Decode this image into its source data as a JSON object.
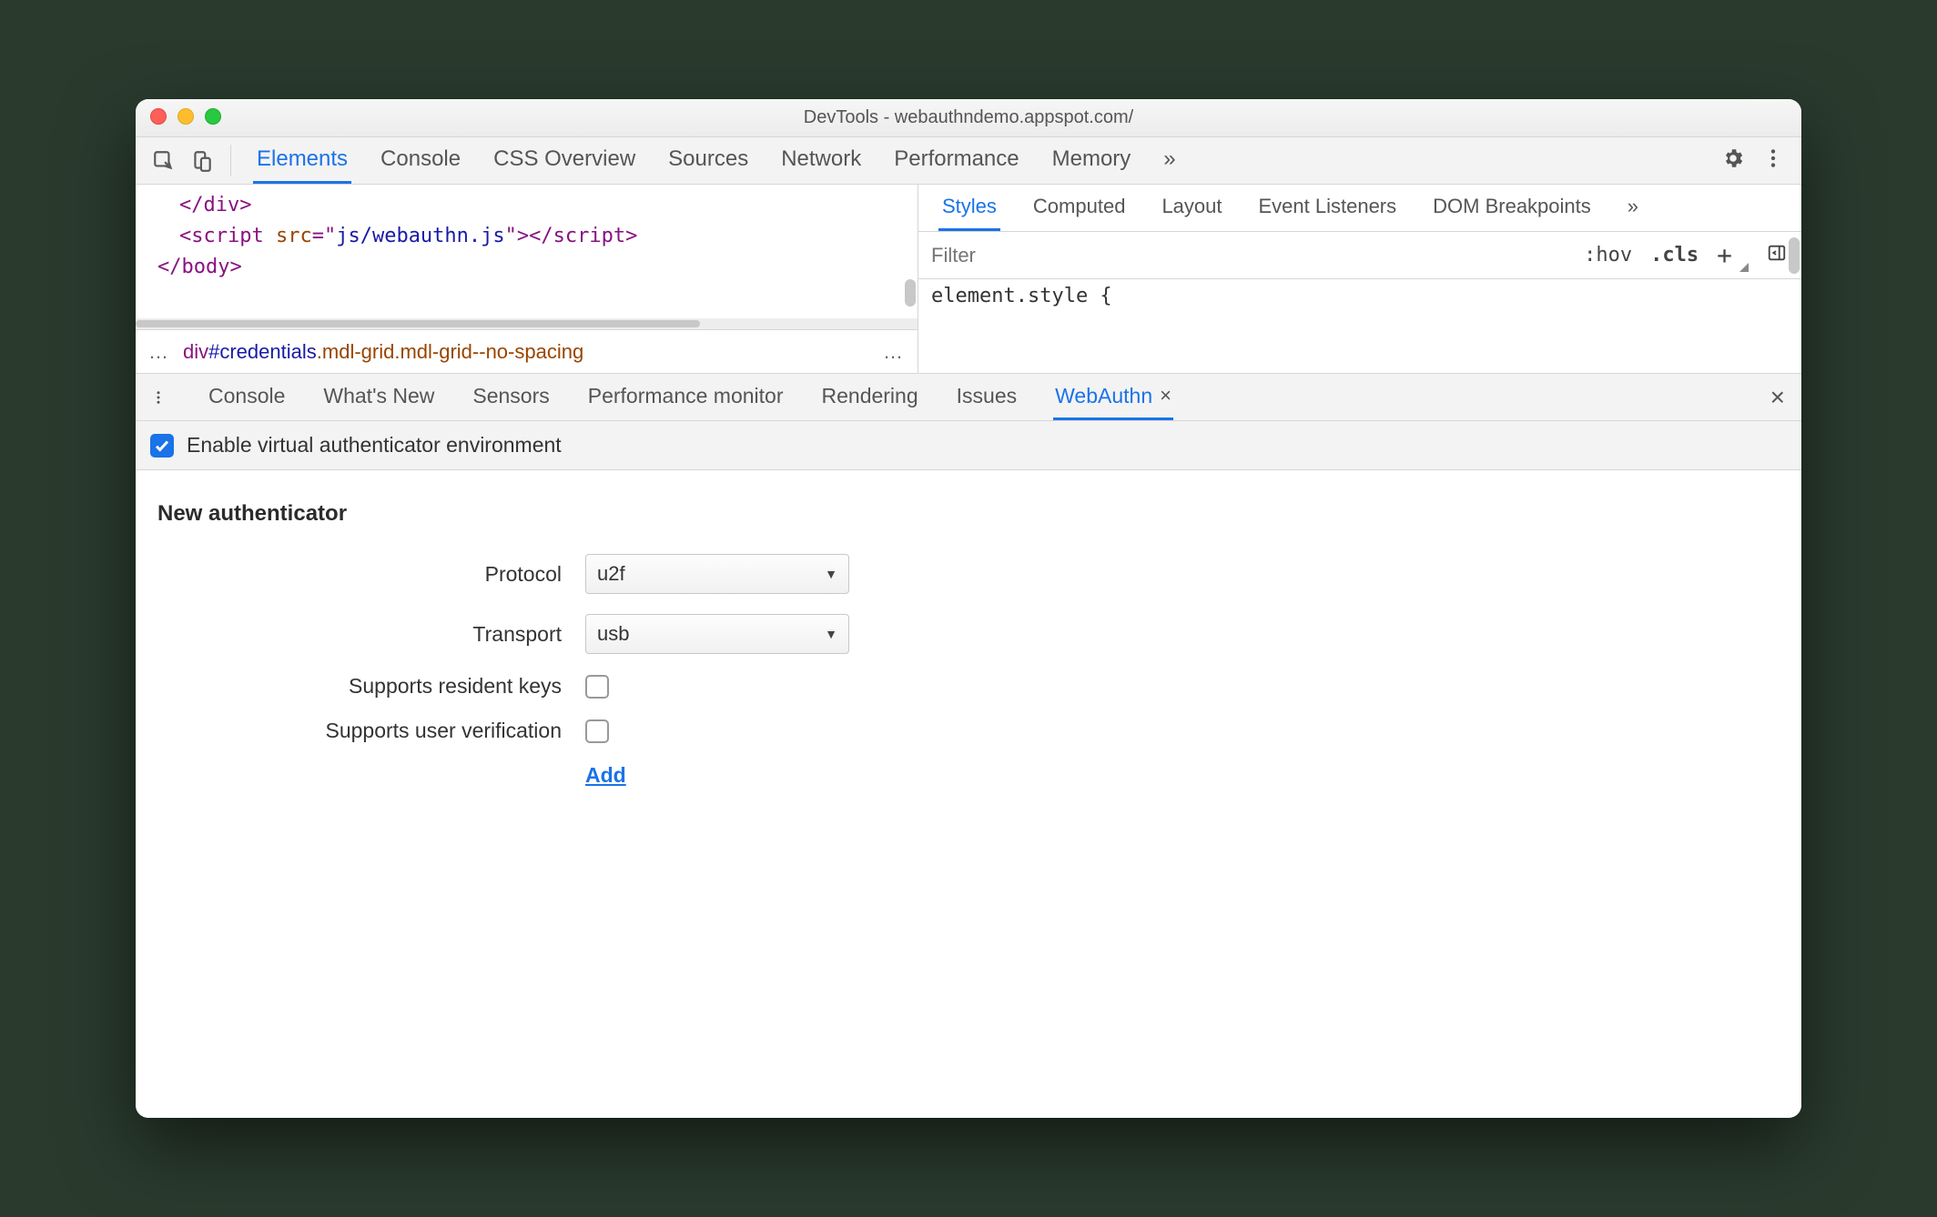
{
  "titlebar": {
    "title": "DevTools - webauthndemo.appspot.com/"
  },
  "main_tabs": {
    "items": [
      "Elements",
      "Console",
      "CSS Overview",
      "Sources",
      "Network",
      "Performance",
      "Memory"
    ],
    "active_index": 0,
    "overflow": "»"
  },
  "code": {
    "line0": "</div>",
    "line1": {
      "open": "<script ",
      "attr": "src",
      "eq": "=\"",
      "val": "js/webauthn.js",
      "closeq": "\">",
      "endtag": "</script>"
    },
    "line2": "</body>"
  },
  "breadcrumb": {
    "dots_left": "…",
    "element": "div",
    "id": "#credentials",
    "classes": ".mdl-grid.mdl-grid--no-spacing",
    "dots_right": "…"
  },
  "right_tabs": {
    "items": [
      "Styles",
      "Computed",
      "Layout",
      "Event Listeners",
      "DOM Breakpoints"
    ],
    "active_index": 0,
    "overflow": "»"
  },
  "filter": {
    "placeholder": "Filter",
    "hov": ":hov",
    "cls": ".cls",
    "plus": "+"
  },
  "styles_body": "element.style {",
  "drawer_tabs": {
    "items": [
      "Console",
      "What's New",
      "Sensors",
      "Performance monitor",
      "Rendering",
      "Issues",
      "WebAuthn"
    ],
    "active_index": 6
  },
  "enable": {
    "label": "Enable virtual authenticator environment",
    "checked": true
  },
  "form": {
    "title": "New authenticator",
    "protocol_label": "Protocol",
    "protocol_value": "u2f",
    "transport_label": "Transport",
    "transport_value": "usb",
    "resident_label": "Supports resident keys",
    "userver_label": "Supports user verification",
    "add": "Add"
  }
}
